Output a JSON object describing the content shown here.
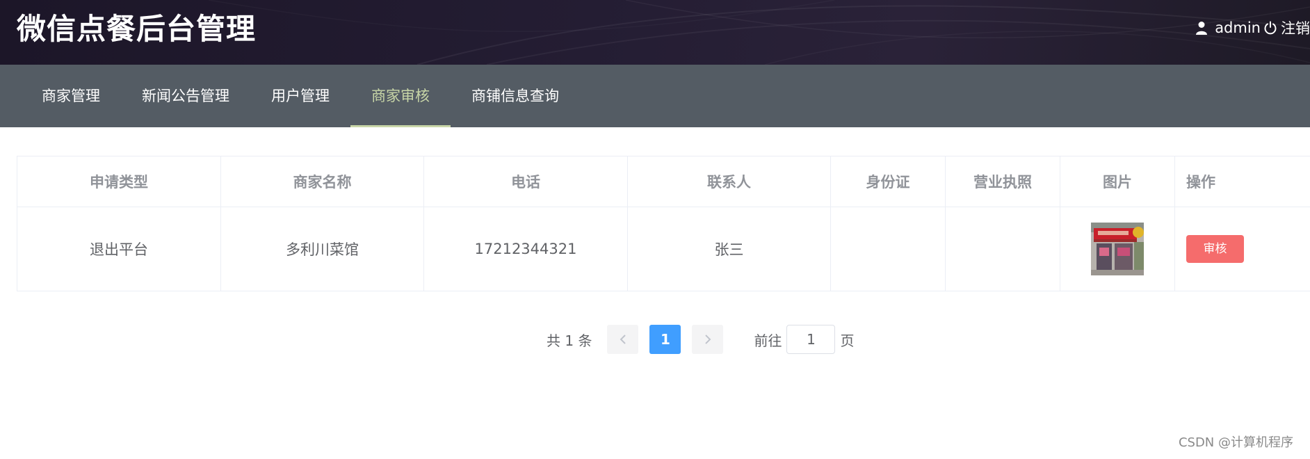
{
  "header": {
    "title": "微信点餐后台管理",
    "username": "admin",
    "logout_label": "注销"
  },
  "nav": {
    "items": [
      {
        "label": "商家管理"
      },
      {
        "label": "新闻公告管理"
      },
      {
        "label": "用户管理"
      },
      {
        "label": "商家审核",
        "active": true
      },
      {
        "label": "商铺信息查询"
      }
    ],
    "active_color": "#c8d6a7",
    "background": "#545c64"
  },
  "table": {
    "headers": [
      "申请类型",
      "商家名称",
      "电话",
      "联系人",
      "身份证",
      "营业执照",
      "图片",
      "操作"
    ],
    "rows": [
      {
        "apply_type": "退出平台",
        "merchant_name": "多利川菜馆",
        "phone": "17212344321",
        "contact": "张三",
        "id_card": "",
        "license": "",
        "image_icon": "storefront-photo",
        "action_label": "审核"
      }
    ]
  },
  "pagination": {
    "total_text": "共 1 条",
    "current_page": "1",
    "goto_label": "前往",
    "goto_value": "1",
    "page_suffix": "页",
    "active_color": "#409eff"
  },
  "watermark": "CSDN @计算机程序",
  "colors": {
    "danger": "#f56c6c",
    "header_bg": "#1c1628"
  }
}
